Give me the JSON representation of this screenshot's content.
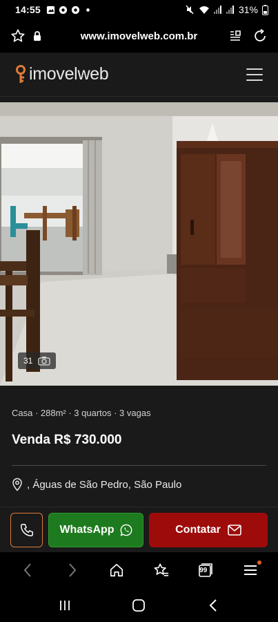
{
  "status_bar": {
    "time": "14:55",
    "battery": "31%",
    "notification_icons": [
      "gallery-icon",
      "chrome-icon",
      "chrome-icon",
      "dot-icon"
    ],
    "system_icons": [
      "mute-icon",
      "wifi-icon",
      "signal-icon",
      "signal-icon",
      "battery-icon"
    ]
  },
  "browser": {
    "url": "www.imovelweb.com.br"
  },
  "site": {
    "logo_text": "imovelweb",
    "brand_color": "#e07b39"
  },
  "photo": {
    "count": "31"
  },
  "listing": {
    "features": "Casa · 288m² · 3 quartos · 3 vagas",
    "price": "Venda R$ 730.000",
    "location": ", Águas de São Pedro, São Paulo"
  },
  "actions": {
    "whatsapp_label": "WhatsApp",
    "contact_label": "Contatar",
    "whatsapp_color": "#1e7a1e",
    "contact_color": "#9e0b0b"
  },
  "browser_toolbar": {
    "tabs_count": "99"
  }
}
